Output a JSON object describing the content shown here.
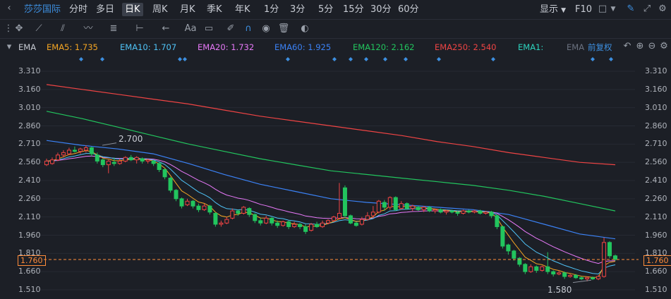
{
  "header": {
    "symbol": "莎莎国际",
    "periods": [
      "分时",
      "多日",
      "日K",
      "周K",
      "月K",
      "季K",
      "年K",
      "1分",
      "3分",
      "5分",
      "15分",
      "30分",
      "60分"
    ],
    "active_period": "日K",
    "display_label": "显示",
    "f10_label": "F10"
  },
  "toolbar": {
    "icons": [
      "crosshair-icon",
      "line-tool-icon",
      "channel-tool-icon",
      "wave-tool-icon",
      "fib-tool-icon",
      "measure-tool-icon",
      "arrow-tool-icon",
      "text-tool-icon",
      "comment-tool-icon",
      "brush-icon",
      "magnet-icon",
      "eye-icon",
      "trash-icon",
      "toggle-icon"
    ],
    "text_tool_label": "Aa"
  },
  "ema_bar": {
    "indicator": "EMA",
    "items": [
      {
        "label": "EMA5: 1.735",
        "color": "#f5a623"
      },
      {
        "label": "EMA10: 1.707",
        "color": "#4fc3f7"
      },
      {
        "label": "EMA20: 1.732",
        "color": "#e879f9"
      },
      {
        "label": "EMA60: 1.925",
        "color": "#3b82f6"
      },
      {
        "label": "EMA120: 2.162",
        "color": "#22c55e"
      },
      {
        "label": "EMA250: 2.540",
        "color": "#ef4444"
      },
      {
        "label": "EMA1:",
        "color": "#2dd4bf"
      },
      {
        "label": "EMA",
        "color": "#6b7280"
      }
    ],
    "adjust_label": "前复权"
  },
  "chart_data": {
    "type": "candlestick",
    "y_ticks": [
      "3.310",
      "3.160",
      "3.010",
      "2.860",
      "2.710",
      "2.560",
      "2.410",
      "2.260",
      "2.110",
      "1.960",
      "1.810",
      "1.660",
      "1.510"
    ],
    "ylim": [
      1.51,
      3.31
    ],
    "current_price": "1.760",
    "high_annotation": "2.700",
    "low_annotation": "1.580",
    "candles": [
      [
        2.54,
        2.57,
        2.59,
        2.53
      ],
      [
        2.55,
        2.58,
        2.6,
        2.54
      ],
      [
        2.58,
        2.62,
        2.64,
        2.57
      ],
      [
        2.62,
        2.64,
        2.66,
        2.6
      ],
      [
        2.63,
        2.66,
        2.68,
        2.62
      ],
      [
        2.66,
        2.65,
        2.69,
        2.64
      ],
      [
        2.65,
        2.67,
        2.68,
        2.63
      ],
      [
        2.66,
        2.68,
        2.7,
        2.64
      ],
      [
        2.68,
        2.63,
        2.69,
        2.61
      ],
      [
        2.62,
        2.57,
        2.64,
        2.55
      ],
      [
        2.58,
        2.54,
        2.59,
        2.52
      ],
      [
        2.54,
        2.57,
        2.58,
        2.47
      ],
      [
        2.56,
        2.55,
        2.6,
        2.53
      ],
      [
        2.55,
        2.57,
        2.59,
        2.54
      ],
      [
        2.57,
        2.6,
        2.61,
        2.56
      ],
      [
        2.6,
        2.58,
        2.62,
        2.57
      ],
      [
        2.58,
        2.6,
        2.61,
        2.55
      ],
      [
        2.59,
        2.57,
        2.6,
        2.55
      ],
      [
        2.57,
        2.58,
        2.59,
        2.55
      ],
      [
        2.57,
        2.55,
        2.58,
        2.53
      ],
      [
        2.55,
        2.5,
        2.56,
        2.48
      ],
      [
        2.5,
        2.44,
        2.51,
        2.42
      ],
      [
        2.43,
        2.33,
        2.44,
        2.31
      ],
      [
        2.33,
        2.26,
        2.34,
        2.24
      ],
      [
        2.26,
        2.2,
        2.27,
        2.18
      ],
      [
        2.21,
        2.24,
        2.26,
        2.2
      ],
      [
        2.24,
        2.2,
        2.25,
        2.18
      ],
      [
        2.2,
        2.17,
        2.22,
        2.15
      ],
      [
        2.17,
        2.2,
        2.22,
        2.16
      ],
      [
        2.2,
        2.15,
        2.21,
        2.13
      ],
      [
        2.14,
        2.05,
        2.15,
        2.03
      ],
      [
        2.05,
        2.06,
        2.08,
        2.03
      ],
      [
        2.06,
        2.09,
        2.11,
        2.05
      ],
      [
        2.1,
        2.16,
        2.18,
        2.09
      ],
      [
        2.16,
        2.14,
        2.17,
        2.12
      ],
      [
        2.14,
        2.19,
        2.2,
        2.13
      ],
      [
        2.18,
        2.13,
        2.19,
        2.11
      ],
      [
        2.13,
        2.08,
        2.14,
        2.06
      ],
      [
        2.08,
        2.06,
        2.1,
        2.04
      ],
      [
        2.06,
        2.1,
        2.12,
        2.05
      ],
      [
        2.1,
        2.06,
        2.11,
        2.04
      ],
      [
        2.06,
        2.04,
        2.08,
        2.02
      ],
      [
        2.04,
        2.07,
        2.08,
        2.03
      ],
      [
        2.07,
        2.03,
        2.08,
        2.01
      ],
      [
        2.03,
        2.05,
        2.07,
        2.02
      ],
      [
        2.05,
        2.03,
        2.06,
        2.01
      ],
      [
        2.03,
        1.99,
        2.05,
        1.97
      ],
      [
        2.0,
        2.05,
        2.06,
        1.99
      ],
      [
        2.05,
        2.03,
        2.07,
        2.02
      ],
      [
        2.03,
        2.06,
        2.08,
        2.02
      ],
      [
        2.06,
        2.08,
        2.09,
        2.05
      ],
      [
        2.08,
        2.11,
        2.12,
        2.07
      ],
      [
        2.1,
        2.14,
        2.39,
        2.09
      ],
      [
        2.35,
        2.12,
        2.37,
        2.1
      ],
      [
        2.12,
        2.06,
        2.13,
        2.05
      ],
      [
        2.06,
        2.04,
        2.07,
        2.03
      ],
      [
        2.05,
        2.09,
        2.11,
        2.04
      ],
      [
        2.09,
        2.12,
        2.15,
        2.08
      ],
      [
        2.12,
        2.15,
        2.2,
        2.1
      ],
      [
        2.15,
        2.24,
        2.25,
        2.14
      ],
      [
        2.23,
        2.19,
        2.25,
        2.16
      ],
      [
        2.19,
        2.27,
        2.28,
        2.17
      ],
      [
        2.27,
        2.17,
        2.28,
        2.16
      ],
      [
        2.18,
        2.22,
        2.24,
        2.17
      ],
      [
        2.22,
        2.18,
        2.23,
        2.17
      ],
      [
        2.18,
        2.2,
        2.21,
        2.16
      ],
      [
        2.19,
        2.17,
        2.2,
        2.16
      ],
      [
        2.17,
        2.19,
        2.2,
        2.15
      ],
      [
        2.19,
        2.16,
        2.2,
        2.15
      ],
      [
        2.16,
        2.17,
        2.18,
        2.14
      ],
      [
        2.17,
        2.15,
        2.18,
        2.14
      ],
      [
        2.15,
        2.16,
        2.17,
        2.13
      ],
      [
        2.16,
        2.15,
        2.17,
        2.14
      ],
      [
        2.15,
        2.14,
        2.16,
        2.12
      ],
      [
        2.14,
        2.16,
        2.17,
        2.13
      ],
      [
        2.16,
        2.15,
        2.17,
        2.14
      ],
      [
        2.15,
        2.16,
        2.17,
        2.14
      ],
      [
        2.16,
        2.14,
        2.17,
        2.13
      ],
      [
        2.14,
        2.15,
        2.16,
        2.13
      ],
      [
        2.15,
        2.12,
        2.16,
        2.1
      ],
      [
        2.12,
        2.03,
        2.13,
        2.01
      ],
      [
        2.03,
        1.87,
        2.04,
        1.85
      ],
      [
        1.88,
        1.83,
        1.89,
        1.8
      ],
      [
        1.83,
        1.77,
        1.84,
        1.75
      ],
      [
        1.77,
        1.72,
        1.78,
        1.7
      ],
      [
        1.72,
        1.66,
        1.73,
        1.64
      ],
      [
        1.66,
        1.7,
        1.72,
        1.65
      ],
      [
        1.7,
        1.67,
        1.71,
        1.65
      ],
      [
        1.67,
        1.7,
        1.71,
        1.66
      ],
      [
        1.7,
        1.66,
        1.82,
        1.64
      ],
      [
        1.66,
        1.64,
        1.67,
        1.62
      ],
      [
        1.64,
        1.65,
        1.67,
        1.63
      ],
      [
        1.65,
        1.62,
        1.66,
        1.6
      ],
      [
        1.62,
        1.63,
        1.64,
        1.61
      ],
      [
        1.63,
        1.61,
        1.64,
        1.6
      ],
      [
        1.61,
        1.6,
        1.62,
        1.59
      ],
      [
        1.6,
        1.61,
        1.62,
        1.58
      ],
      [
        1.61,
        1.6,
        1.62,
        1.59
      ],
      [
        1.6,
        1.62,
        1.63,
        1.59
      ],
      [
        1.62,
        1.9,
        1.94,
        1.61
      ],
      [
        1.9,
        1.79,
        1.91,
        1.77
      ],
      [
        1.79,
        1.76,
        1.8,
        1.75
      ]
    ],
    "ema250": [
      3.2,
      3.16,
      3.12,
      3.08,
      3.04,
      2.99,
      2.94,
      2.9,
      2.86,
      2.82,
      2.78,
      2.73,
      2.69,
      2.64,
      2.6,
      2.56,
      2.54
    ],
    "ema120": [
      2.98,
      2.92,
      2.85,
      2.78,
      2.71,
      2.65,
      2.59,
      2.54,
      2.49,
      2.46,
      2.43,
      2.4,
      2.37,
      2.33,
      2.28,
      2.22,
      2.16
    ],
    "ema60": [
      2.74,
      2.7,
      2.67,
      2.63,
      2.55,
      2.46,
      2.38,
      2.32,
      2.26,
      2.23,
      2.21,
      2.19,
      2.17,
      2.13,
      2.05,
      1.97,
      1.93
    ]
  }
}
